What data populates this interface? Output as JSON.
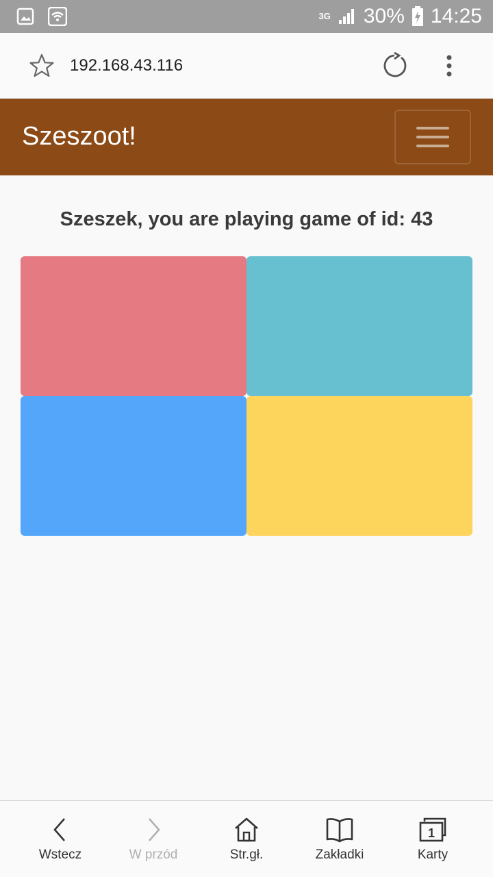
{
  "status_bar": {
    "network_type": "3G",
    "battery_percent": "30%",
    "time": "14:25",
    "icons": [
      "gallery-icon",
      "wifi-icon",
      "signal-icon",
      "battery-charging-icon"
    ]
  },
  "browser": {
    "url": "192.168.43.116",
    "icons": [
      "star-icon",
      "reload-icon",
      "more-vert-icon"
    ]
  },
  "navbar": {
    "brand": "Szeszoot!",
    "background_color": "#8b4a16",
    "toggler_icon": "hamburger-icon"
  },
  "main": {
    "heading": "Szeszek, you are playing game of id: 43",
    "tiles": [
      {
        "color": "#e57a83"
      },
      {
        "color": "#67c0d0"
      },
      {
        "color": "#54a6fb"
      },
      {
        "color": "#fdd55d"
      }
    ]
  },
  "bottom_bar": {
    "items": [
      {
        "label": "Wstecz",
        "icon": "back-arrow-icon",
        "enabled": true
      },
      {
        "label": "W przód",
        "icon": "forward-arrow-icon",
        "enabled": false
      },
      {
        "label": "Str.gł.",
        "icon": "home-icon",
        "enabled": true
      },
      {
        "label": "Zakładki",
        "icon": "bookmarks-icon",
        "enabled": true
      },
      {
        "label": "Karty",
        "icon": "tabs-icon",
        "enabled": true,
        "tab_count": "1"
      }
    ]
  }
}
